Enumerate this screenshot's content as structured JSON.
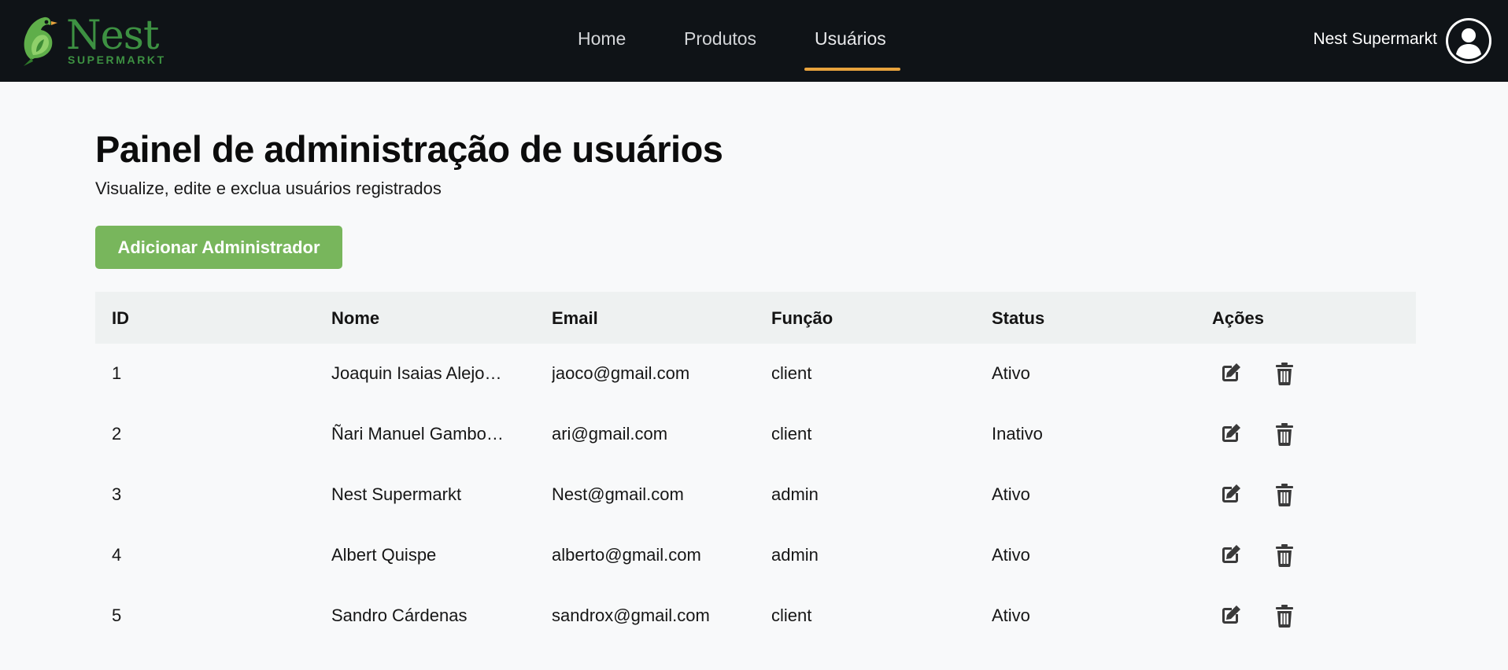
{
  "header": {
    "logo_name": "Nest",
    "logo_sub": "SUPERMARKT",
    "nav": [
      {
        "label": "Home",
        "active": false
      },
      {
        "label": "Produtos",
        "active": false
      },
      {
        "label": "Usuários",
        "active": true
      }
    ],
    "user_name": "Nest Supermarkt",
    "avatar_icon": "user-circle-icon"
  },
  "main": {
    "title": "Painel de administração de usuários",
    "subtitle": "Visualize, edite e exclua usuários registrados",
    "add_button_label": "Adicionar Administrador"
  },
  "table": {
    "columns": [
      "ID",
      "Nome",
      "Email",
      "Função",
      "Status",
      "Ações"
    ],
    "rows": [
      {
        "id": "1",
        "name": "Joaquin Isaias Alejo…",
        "email": "jaoco@gmail.com",
        "role": "client",
        "status": "Ativo"
      },
      {
        "id": "2",
        "name": "Ñari Manuel Gambo…",
        "email": "ari@gmail.com",
        "role": "client",
        "status": "Inativo"
      },
      {
        "id": "3",
        "name": "Nest Supermarkt",
        "email": "Nest@gmail.com",
        "role": "admin",
        "status": "Ativo"
      },
      {
        "id": "4",
        "name": "Albert Quispe",
        "email": "alberto@gmail.com",
        "role": "admin",
        "status": "Ativo"
      },
      {
        "id": "5",
        "name": "Sandro Cárdenas",
        "email": "sandrox@gmail.com",
        "role": "client",
        "status": "Ativo"
      }
    ],
    "action_icons": [
      "edit-icon",
      "trash-icon"
    ]
  },
  "colors": {
    "topbar": "#0f1317",
    "accent_underline": "#e8a33d",
    "brand_green": "#3d9142",
    "button_green": "#78b65c",
    "page_bg": "#f8f9fa",
    "table_header_bg": "#eef1f1"
  }
}
